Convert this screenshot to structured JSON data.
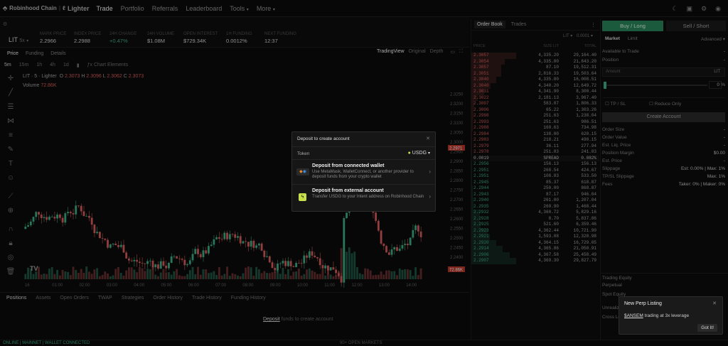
{
  "nav": {
    "brand": "Robinhood Chain",
    "brand2": "Lighter",
    "items": [
      "Trade",
      "Portfolio",
      "Referrals",
      "Leaderboard",
      "Tools",
      "More"
    ]
  },
  "market": {
    "symbol": "LIT",
    "symbol_tag": "5x",
    "stats": [
      {
        "label": "MARK PRICE",
        "value": "2.2966"
      },
      {
        "label": "INDEX PRICE",
        "value": "2.2988"
      },
      {
        "label": "24H CHANGE",
        "value": "+0.47%"
      },
      {
        "label": "24H VOLUME",
        "value": "$1.08M"
      },
      {
        "label": "OPEN INTEREST",
        "value": "$729.34K"
      },
      {
        "label": "1H FUNDING",
        "value": "0.0012%"
      },
      {
        "label": "NEXT FUNDING",
        "value": "12:37"
      }
    ]
  },
  "subtabs": [
    "Price",
    "Funding",
    "Details"
  ],
  "viewtabs": [
    "TradingView",
    "Original",
    "Depth"
  ],
  "chart_toolbar": {
    "interval": "5m",
    "items": [
      "15m",
      "1h",
      "4h",
      "1d"
    ],
    "indicators": "Chart Elements"
  },
  "legend": {
    "line1": "LIT · 5 · Lighter",
    "o": "2.3073",
    "h": "2.3096",
    "l": "2.3062",
    "c": "2.3073",
    "volume": "Volume",
    "volume_val": "72.86K"
  },
  "chart_data": {
    "type": "candlestick",
    "y_ticks": [
      "2.3300",
      "2.3250",
      "2.3200",
      "2.3150",
      "2.3100",
      "2.3050",
      "2.3000",
      "2.2950",
      "2.2900",
      "2.2850",
      "2.2800",
      "2.2750",
      "2.2700",
      "2.2650",
      "2.2600",
      "2.2550",
      "2.2500",
      "2.2450",
      "2.2400"
    ],
    "x_ticks": [
      "16",
      "01:00",
      "02:00",
      "03:00",
      "04:00",
      "05:00",
      "06:00",
      "07:00",
      "08:00",
      "09:00",
      "10:00",
      "11:00",
      "12:00",
      "13:00",
      "14:00"
    ],
    "last_price": "2.2971",
    "last_volume": "72.86K"
  },
  "bottom_tabs": [
    "Positions",
    "Assets",
    "Open Orders",
    "TWAP",
    "Strategies",
    "Order History",
    "Trade History",
    "Funding History"
  ],
  "deposit_hint": {
    "link": "Deposit",
    "text": "funds to create account"
  },
  "status": {
    "left": "ONLINE | MAINNET | WALLET CONNECTED",
    "center": "90+ OPEN MARKETS"
  },
  "orderbook": {
    "tabs": [
      "Order Book",
      "Trades"
    ],
    "symbol": "LIT",
    "tick": "0.0001",
    "headers": [
      "PRICE",
      "SIZE LIT",
      "TOTAL"
    ],
    "asks": [
      [
        "2.3057",
        "4,335.20",
        "29,164.40"
      ],
      [
        "2.3054",
        "4,335.80",
        "21,843.20"
      ],
      [
        "2.3057",
        "87.10",
        "19,512.31"
      ],
      [
        "2.3051",
        "2,816.33",
        "19,503.64"
      ],
      [
        "2.3040",
        "4,335.80",
        "16,008.51"
      ],
      [
        "2.3040",
        "4,340.20",
        "12,649.72"
      ],
      [
        "2.3031",
        "4,341.90",
        "8,300.44"
      ],
      [
        "2.3022",
        "2,181.13",
        "3,967.40"
      ],
      [
        "2.3007",
        "583.07",
        "1,806.33"
      ],
      [
        "2.3006",
        "65.22",
        "1,303.26"
      ],
      [
        "2.2998",
        "251.63",
        "1,238.04"
      ],
      [
        "2.2993",
        "251.63",
        "986.51"
      ],
      [
        "2.2988",
        "160.63",
        "734.98"
      ],
      [
        "2.2984",
        "138.00",
        "620.15"
      ],
      [
        "2.2983",
        "218.21",
        "490.15"
      ],
      [
        "2.2979",
        "36.11",
        "277.94"
      ],
      [
        "2.2978",
        "251.83",
        "241.83"
      ]
    ],
    "spread": [
      "0.0019",
      "SPREAD",
      "0.082%"
    ],
    "bids": [
      [
        "2.2956",
        "156.13",
        "156.13"
      ],
      [
        "2.2951",
        "268.54",
        "424.67"
      ],
      [
        "2.2951",
        "108.83",
        "533.50"
      ],
      [
        "2.2945",
        "85.37",
        "618.87"
      ],
      [
        "2.2944",
        "250.00",
        "868.87"
      ],
      [
        "2.2943",
        "87.17",
        "946.04"
      ],
      [
        "2.2940",
        "261.00",
        "1,207.04"
      ],
      [
        "2.2935",
        "260.90",
        "1,468.44"
      ],
      [
        "2.2932",
        "4,360.72",
        "5,829.16"
      ],
      [
        "2.2928",
        "8.70",
        "5,837.86"
      ],
      [
        "2.2925",
        "521.60",
        "6,359.46"
      ],
      [
        "2.2923",
        "4,362.44",
        "10,721.90"
      ],
      [
        "2.2921",
        "1,593.08",
        "12,320.98"
      ],
      [
        "2.2920",
        "4,364.15",
        "16,729.05"
      ],
      [
        "2.2914",
        "4,365.86",
        "21,050.91"
      ],
      [
        "2.2906",
        "4,367.58",
        "25,458.49"
      ],
      [
        "2.2907",
        "4,369.30",
        "29,827.79"
      ]
    ]
  },
  "trade": {
    "buy": "Buy / Long",
    "sell": "Sell / Short",
    "order_tabs": [
      "Market",
      "Limit"
    ],
    "advanced": "Advanced",
    "available": "Available to Trade",
    "position": "Position",
    "amount_placeholder": "Amount",
    "amount_unit": "LIT",
    "pct": "0",
    "pct_unit": "%",
    "tpsl": "TP / SL",
    "reduce": "Reduce Only",
    "create": "Create Account",
    "rows": [
      {
        "label": "Order Size",
        "value": "-"
      },
      {
        "label": "Order Value",
        "value": "-"
      },
      {
        "label": "Est. Liq. Price",
        "value": "-"
      },
      {
        "label": "Position Margin",
        "value": "$0.00"
      },
      {
        "label": "Est. Price",
        "value": "-"
      },
      {
        "label": "Slippage",
        "value": "Est: 0.00% | Max: 1%"
      },
      {
        "label": "TP/SL Slippage",
        "value": "Max: 1%"
      },
      {
        "label": "Fees",
        "value": "Taker: 0% | Maker: 0%"
      }
    ],
    "lower": [
      "Trading Equity",
      "Perpetual",
      "Spot Equity",
      "Unrealized",
      "Cross Lev"
    ]
  },
  "modal": {
    "title": "Deposit to create account",
    "token_label": "Token",
    "token_value": "USDG",
    "options": [
      {
        "title": "Deposit from connected wallet",
        "desc": "Use MetaMask, WalletConnect, or another provider to deposit funds from your crypto wallet"
      },
      {
        "title": "Deposit from external account",
        "desc": "Transfer USDG to your Intent address on Robinhood Chain"
      }
    ]
  },
  "toast": {
    "title": "New Perp Listing",
    "symbol": "$ANSEM",
    "text": "trading at 3x leverage",
    "button": "Got It!"
  },
  "colors": {
    "green": "#3fb68b",
    "red": "#e06060",
    "accent": "#2a8a5e"
  }
}
